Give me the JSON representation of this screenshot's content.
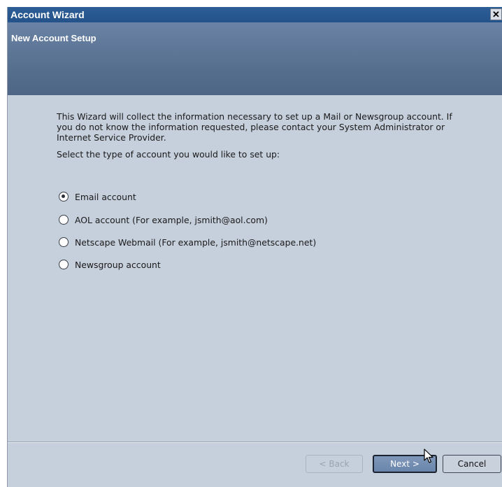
{
  "window": {
    "title": "Account Wizard",
    "close_glyph": "✕"
  },
  "header": {
    "subtitle": "New Account Setup"
  },
  "content": {
    "intro": "This Wizard will collect the information necessary to set up a Mail or Newsgroup account. If you do not know the information requested, please contact your System Administrator or Internet Service Provider.",
    "prompt": "Select the type of account you would like to set up:",
    "options": [
      {
        "label": "Email account",
        "selected": true
      },
      {
        "label": "AOL account (For example, jsmith@aol.com)",
        "selected": false
      },
      {
        "label": "Netscape Webmail (For example, jsmith@netscape.net)",
        "selected": false
      },
      {
        "label": "Newsgroup account",
        "selected": false
      }
    ]
  },
  "buttons": {
    "back": "< Back",
    "next": "Next >",
    "cancel": "Cancel"
  }
}
